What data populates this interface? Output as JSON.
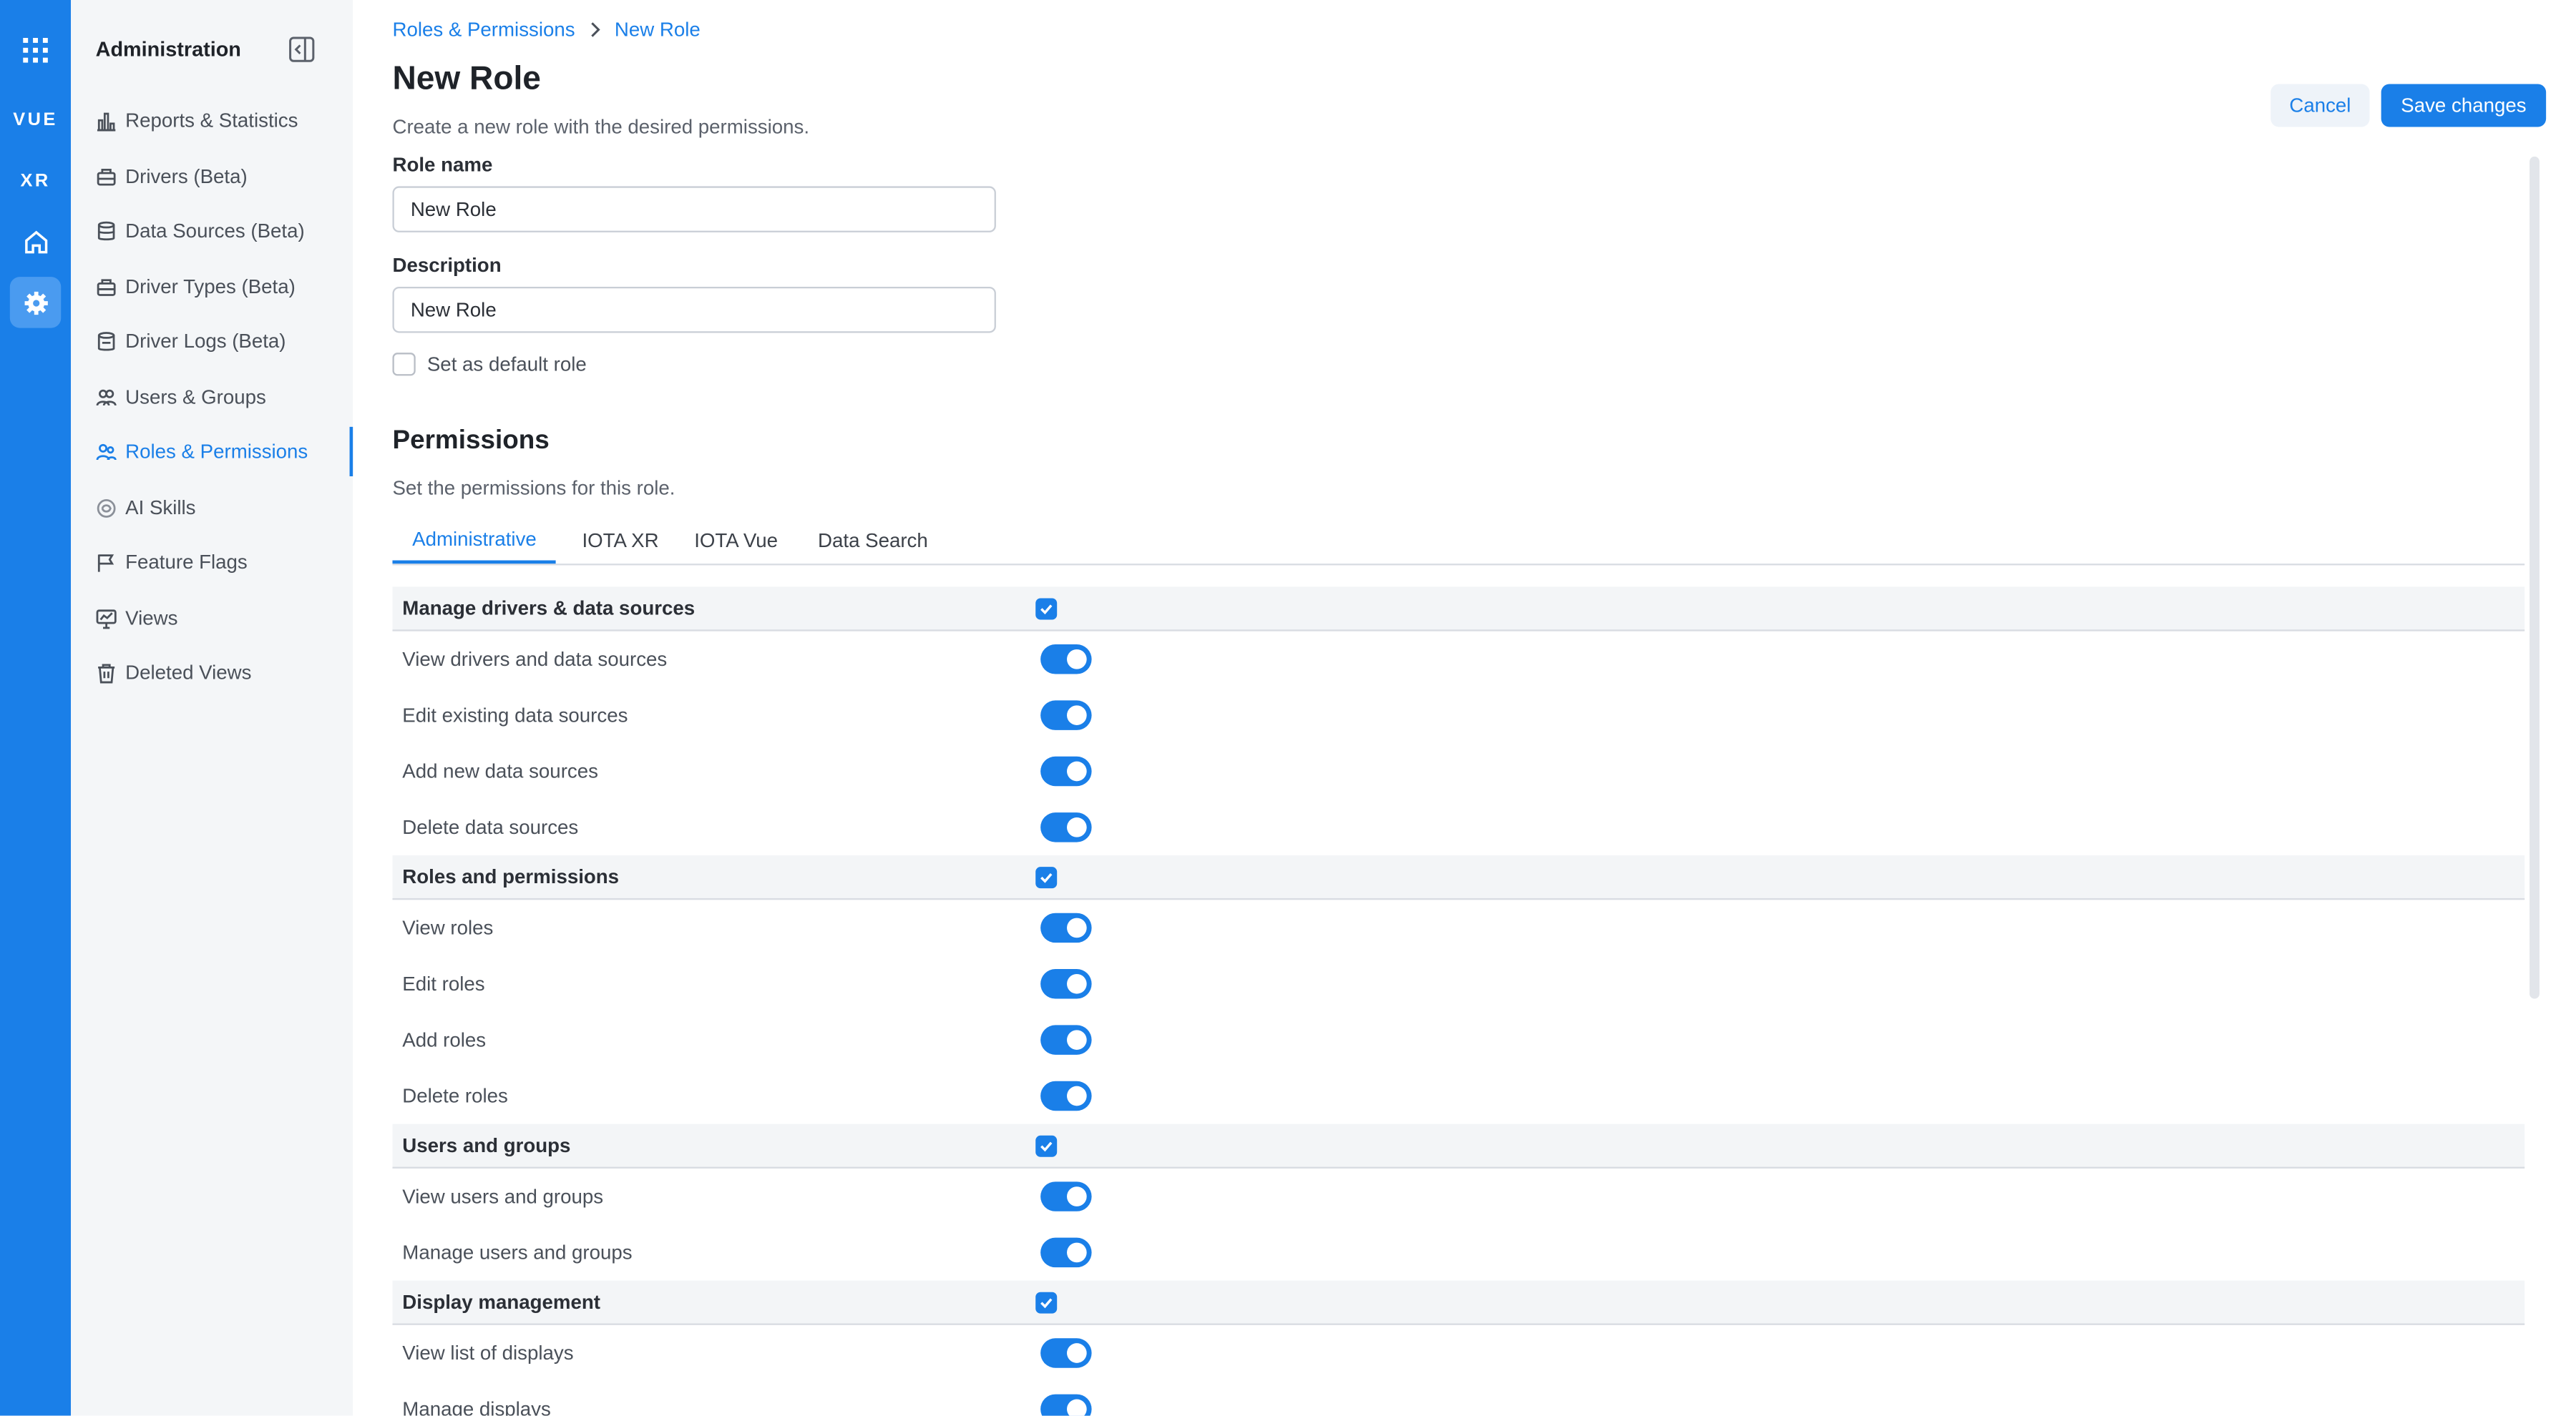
{
  "rail": {
    "vue_label": "VUE",
    "xr_label": "XR",
    "accent_color": "#1a7fe8"
  },
  "sidebar": {
    "title": "Administration",
    "items": [
      {
        "label": "Reports & Statistics",
        "icon": "bar-chart-icon"
      },
      {
        "label": "Drivers (Beta)",
        "icon": "driver-icon"
      },
      {
        "label": "Data Sources (Beta)",
        "icon": "database-icon"
      },
      {
        "label": "Driver Types (Beta)",
        "icon": "driver-type-icon"
      },
      {
        "label": "Driver Logs (Beta)",
        "icon": "log-icon"
      },
      {
        "label": "Users & Groups",
        "icon": "users-icon"
      },
      {
        "label": "Roles & Permissions",
        "icon": "roles-icon",
        "active": true
      },
      {
        "label": "AI Skills",
        "icon": "ai-icon"
      },
      {
        "label": "Feature Flags",
        "icon": "flag-icon"
      },
      {
        "label": "Views",
        "icon": "monitor-icon"
      },
      {
        "label": "Deleted Views",
        "icon": "trash-icon"
      }
    ]
  },
  "breadcrumb": {
    "parent": "Roles & Permissions",
    "current": "New Role"
  },
  "header": {
    "title": "New Role",
    "subtitle": "Create a new role with the desired permissions.",
    "cancel_label": "Cancel",
    "save_label": "Save changes"
  },
  "form": {
    "role_name_label": "Role name",
    "role_name_value": "New Role",
    "description_label": "Description",
    "description_value": "New Role",
    "default_role_label": "Set as default role",
    "default_role_checked": false
  },
  "permissions": {
    "title": "Permissions",
    "subtitle": "Set the permissions for this role.",
    "tabs": [
      {
        "label": "Administrative",
        "active": true
      },
      {
        "label": "IOTA XR"
      },
      {
        "label": "IOTA Vue"
      },
      {
        "label": "Data Search"
      }
    ],
    "groups": [
      {
        "name": "Manage drivers & data sources",
        "checked": true,
        "items": [
          "View drivers and data sources",
          "Edit existing data sources",
          "Add new data sources",
          "Delete data sources"
        ]
      },
      {
        "name": "Roles and permissions",
        "checked": true,
        "items": [
          "View roles",
          "Edit roles",
          "Add roles",
          "Delete roles"
        ]
      },
      {
        "name": "Users and groups",
        "checked": true,
        "items": [
          "View users and groups",
          "Manage users and groups"
        ]
      },
      {
        "name": "Display management",
        "checked": true,
        "items": [
          "View list of displays",
          "Manage displays"
        ]
      }
    ]
  }
}
